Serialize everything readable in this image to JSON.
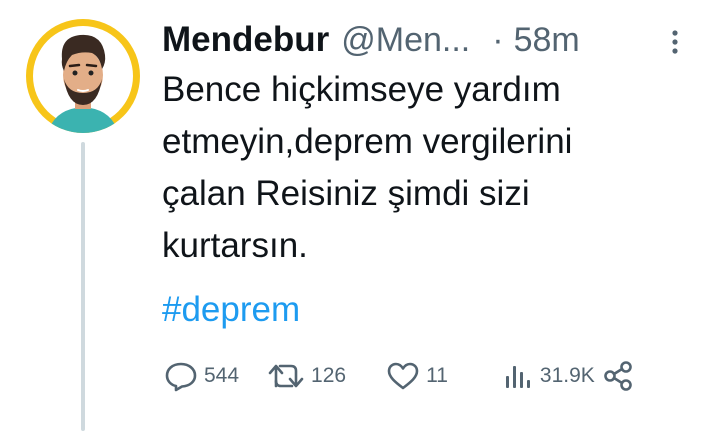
{
  "tweet": {
    "author_name": "Mendebur",
    "handle": "@Men...",
    "separator": "·",
    "time": "58m",
    "text_lines": [
      "Bence hiçkimseye yardım",
      "etmeyin,deprem vergilerini",
      "çalan Reisiniz şimdi sizi",
      "kurtarsın."
    ],
    "hashtag": "#deprem"
  },
  "actions": {
    "reply_count": "544",
    "retweet_count": "126",
    "like_count": "11",
    "views_count": "31.9K"
  },
  "icons": {
    "reply": "reply-icon",
    "retweet": "retweet-icon",
    "like": "heart-icon",
    "views": "views-icon",
    "share": "share-icon",
    "more": "more-options-icon"
  },
  "colors": {
    "text": "#0f1419",
    "muted": "#536471",
    "link": "#1d9bf0",
    "avatar_ring": "#f7c519",
    "thread_line": "#cfd9de"
  }
}
